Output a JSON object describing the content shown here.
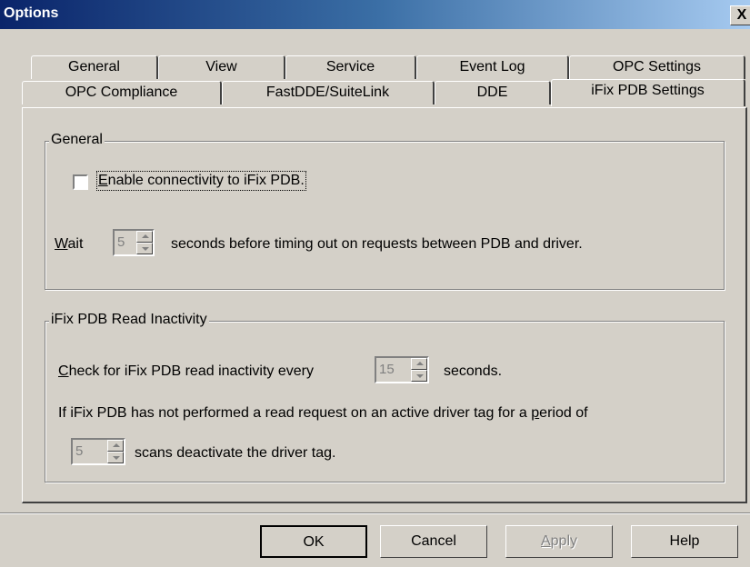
{
  "window": {
    "title": "Options",
    "close_label": "X"
  },
  "tabs_row1": [
    "General",
    "View",
    "Service",
    "Event Log",
    "OPC Settings"
  ],
  "tabs_row2": [
    "OPC Compliance",
    "FastDDE/SuiteLink",
    "DDE",
    "iFix PDB Settings"
  ],
  "active_tab": "iFix PDB Settings",
  "general_group": {
    "legend": "General",
    "enable_label_mnemonic": "E",
    "enable_label_rest": "nable connectivity to iFix PDB.",
    "enable_checked": false,
    "wait_mnemonic": "W",
    "wait_rest": "ait",
    "wait_value": "5",
    "wait_suffix": "seconds before timing out on requests between PDB and driver."
  },
  "inactivity_group": {
    "legend": "iFix PDB Read Inactivity",
    "check_mnemonic": "C",
    "check_rest": "heck for iFix PDB read inactivity every",
    "check_value": "15",
    "check_suffix": "seconds.",
    "line2_prefix": "If iFix PDB has not performed a read request on an active driver tag for a ",
    "line2_mnemonic": "p",
    "line2_rest": "eriod of",
    "scans_value": "5",
    "scans_suffix": "scans deactivate the driver tag."
  },
  "buttons": {
    "ok": "OK",
    "cancel": "Cancel",
    "apply_mnemonic": "A",
    "apply_rest": "pply",
    "help": "Help"
  }
}
